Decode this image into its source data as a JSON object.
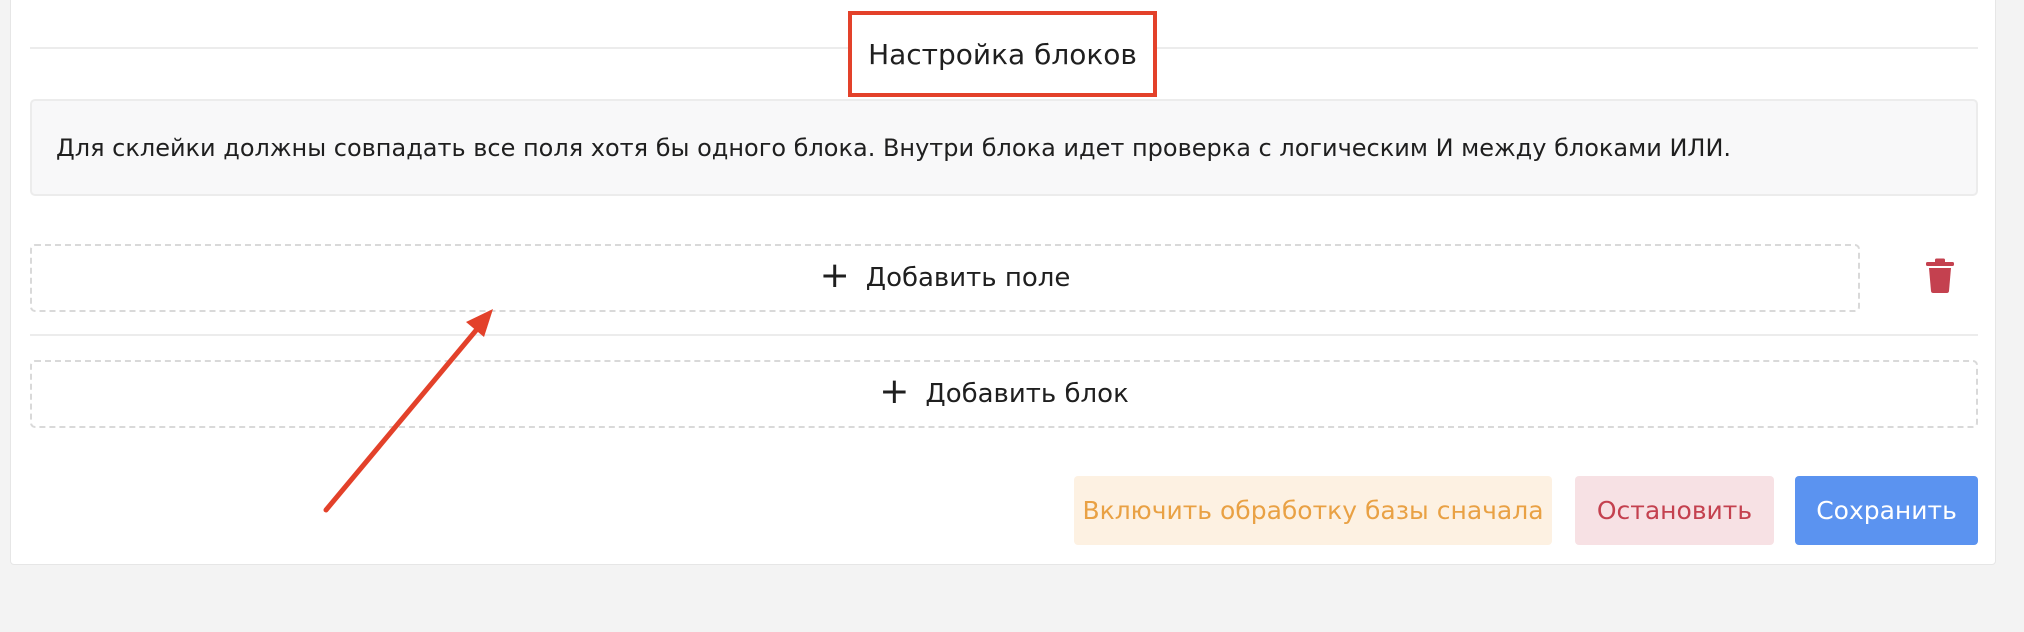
{
  "section": {
    "title": "Настройка блоков"
  },
  "info": {
    "text": "Для склейки должны совпадать все поля хотя бы одного блока. Внутри блока идет проверка с логическим И между блоками ИЛИ."
  },
  "block": {
    "add_field_label": "Добавить поле",
    "add_field_icon": "plus-icon",
    "delete_icon": "trash-icon"
  },
  "add_block": {
    "label": "Добавить блок",
    "icon": "plus-icon"
  },
  "actions": {
    "enable_processing_label": "Включить обработку базы сначала",
    "stop_label": "Остановить",
    "save_label": "Сохранить"
  },
  "colors": {
    "highlight": "#e3412a",
    "warning_text": "#e9a144",
    "warning_bg": "#fdf1e2",
    "danger_text": "#c4414f",
    "danger_bg": "#f7e1e4",
    "primary": "#5b93f0",
    "trash": "#c4414f"
  }
}
